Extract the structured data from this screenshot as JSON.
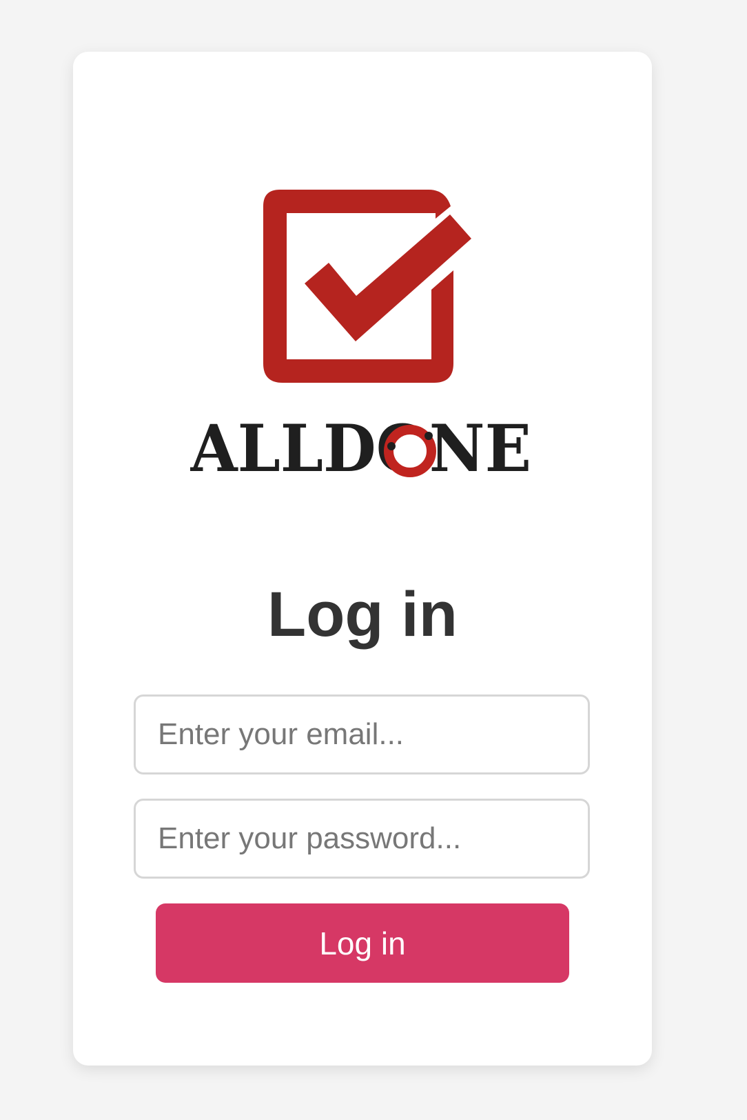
{
  "brand": {
    "name": "ALLDONE",
    "logo_icon": "checkbox-check-icon",
    "colors": {
      "logo_red": "#b5241f",
      "wordmark_black": "#1f1f1f"
    }
  },
  "login": {
    "title": "Log in",
    "email": {
      "placeholder": "Enter your email...",
      "value": ""
    },
    "password": {
      "placeholder": "Enter your password...",
      "value": ""
    },
    "submit_label": "Log in",
    "colors": {
      "button": "#d63865",
      "title": "#333333"
    }
  }
}
